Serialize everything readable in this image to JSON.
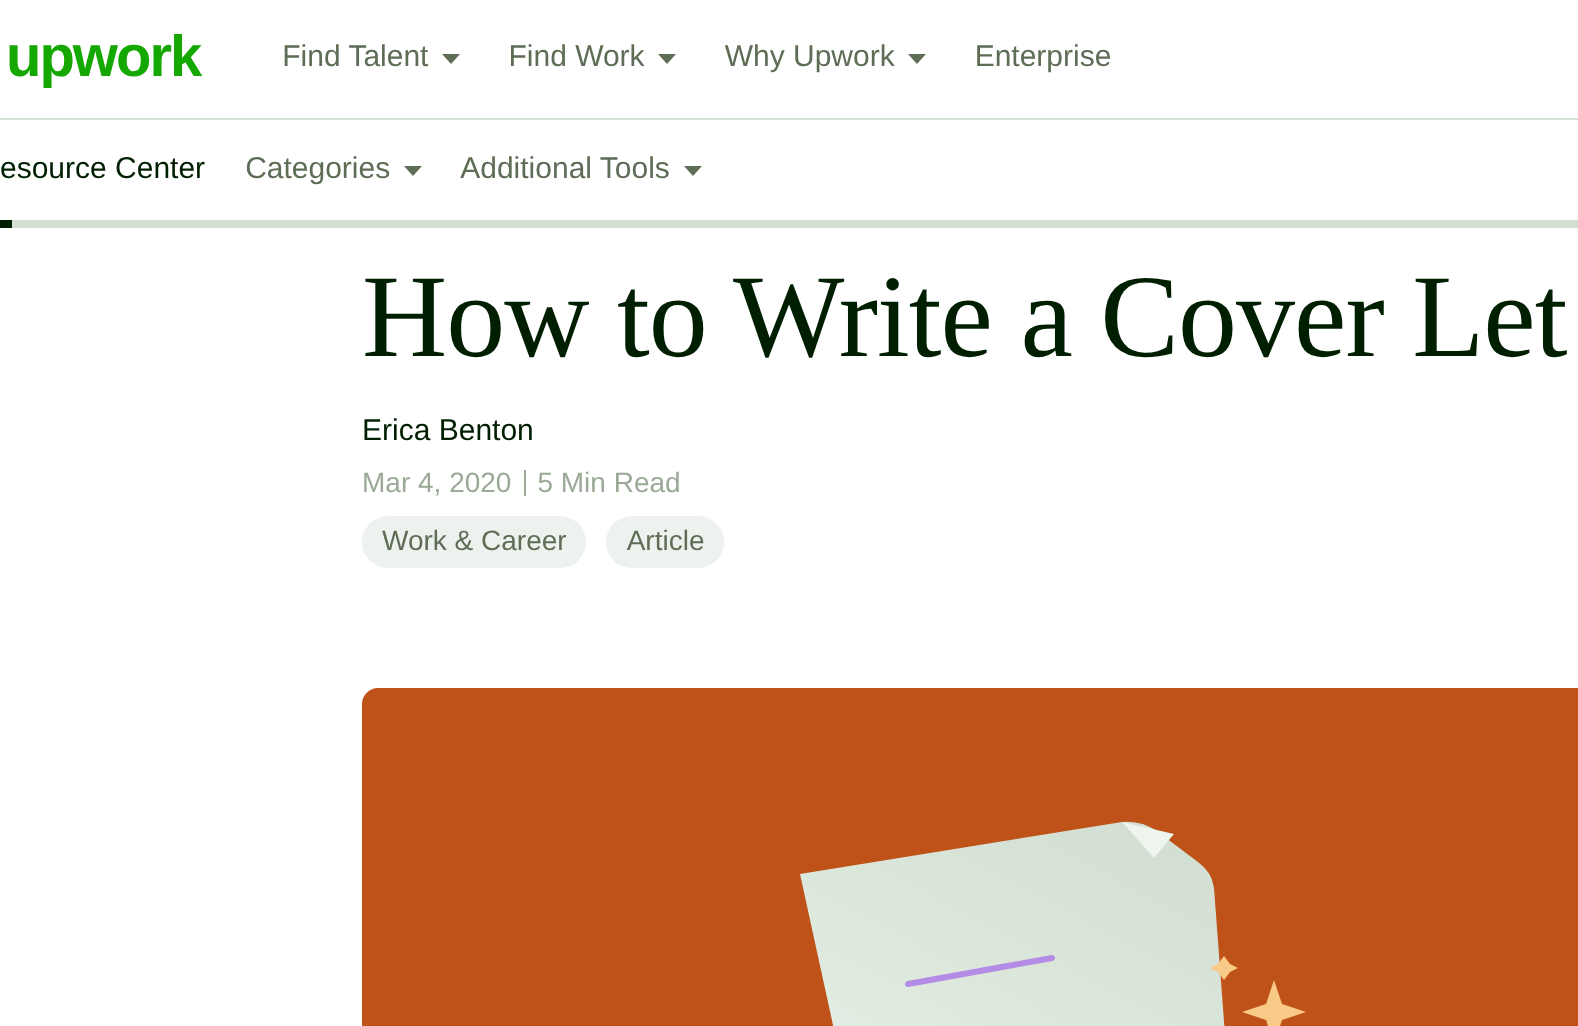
{
  "header": {
    "logo": "upwork",
    "nav": [
      {
        "label": "Find Talent",
        "dropdown": true
      },
      {
        "label": "Find Work",
        "dropdown": true
      },
      {
        "label": "Why Upwork",
        "dropdown": true
      },
      {
        "label": "Enterprise",
        "dropdown": false
      }
    ]
  },
  "subnav": {
    "title": "esource Center",
    "items": [
      {
        "label": "Categories",
        "dropdown": true
      },
      {
        "label": "Additional Tools",
        "dropdown": true
      }
    ]
  },
  "reading_progress": {
    "level": 0.008
  },
  "article": {
    "title": "How to Write a Cover Let",
    "author": "Erica Benton",
    "date": "Mar 4, 2020",
    "read_time": "5 Min Read",
    "tags": [
      "Work & Career",
      "Article"
    ]
  }
}
